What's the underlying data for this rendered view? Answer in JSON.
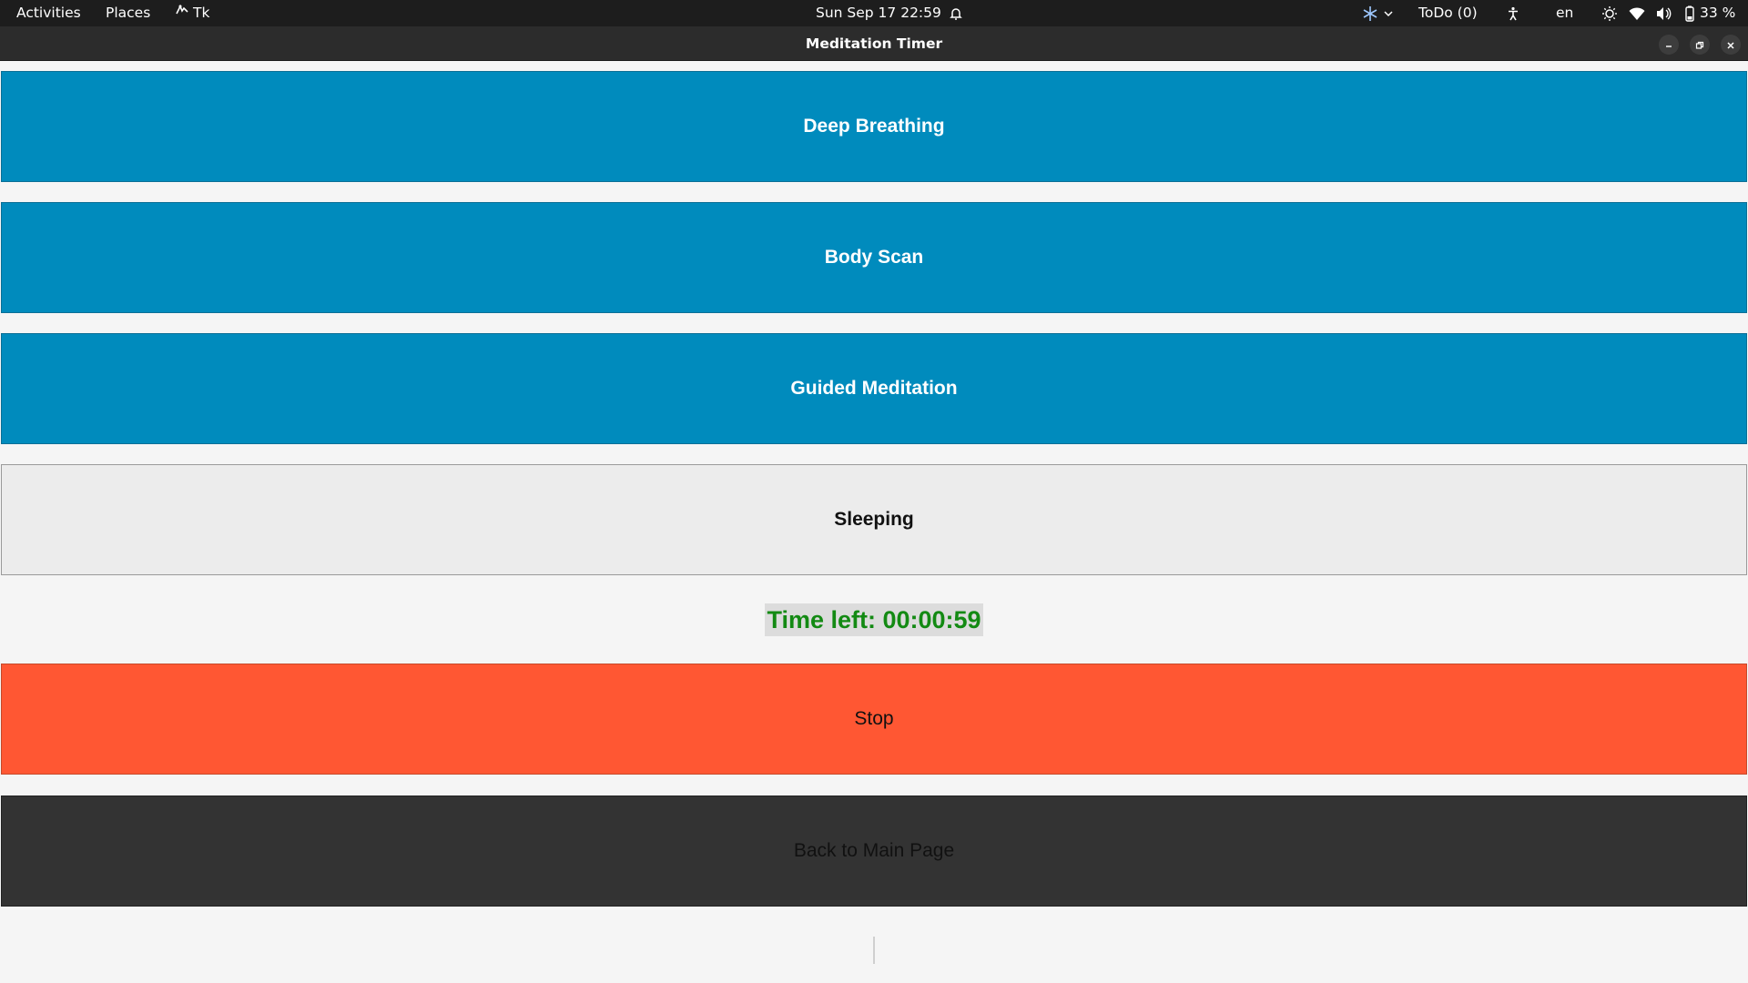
{
  "topbar": {
    "activities": "Activities",
    "places": "Places",
    "app_name": "Tk",
    "clock": "Sun Sep 17  22:59",
    "todo": "ToDo (0)",
    "language": "en",
    "battery": "33 %"
  },
  "window": {
    "title": "Meditation Timer"
  },
  "buttons": {
    "deep_breathing": "Deep Breathing",
    "body_scan": "Body Scan",
    "guided_meditation": "Guided Meditation",
    "sleeping": "Sleeping",
    "stop": "Stop",
    "back": "Back to Main Page"
  },
  "timer": {
    "label": "Time left: 00:00:59"
  },
  "colors": {
    "session_button": "#008bbd",
    "selected_button": "#ececec",
    "stop_button": "#ff5733",
    "back_button": "#333333",
    "timer_text": "#138a13"
  }
}
